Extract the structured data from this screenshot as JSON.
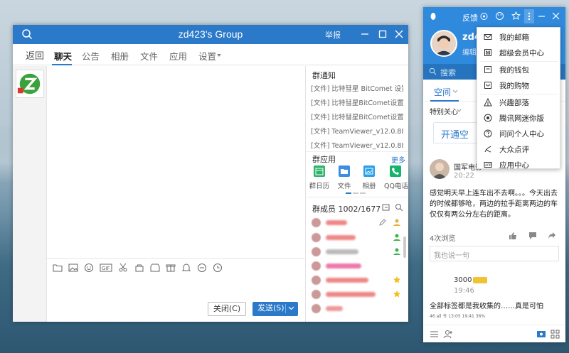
{
  "group_window": {
    "title": "zd423's Group",
    "report": "举报",
    "back": "返回",
    "tabs": [
      "聊天",
      "公告",
      "相册",
      "文件",
      "应用",
      "设置"
    ],
    "notice_header": "群通知",
    "notices": [
      "[文件] 比特彗星 BitComet 设置...",
      "[文件] 比特彗星BitComet设置...",
      "[文件] 比特彗星BitComet设置...",
      "[文件] TeamViewer_v12.0.884...",
      "[文件] TeamViewer_v12.0.884..."
    ],
    "apps_header": "群应用",
    "apps_more": "更多",
    "apps": [
      {
        "label": "群日历",
        "color": "#2fb36d"
      },
      {
        "label": "文件",
        "color": "#3a8ee6"
      },
      {
        "label": "相册",
        "color": "#2aa0e8"
      },
      {
        "label": "QQ电话",
        "color": "#16b36a"
      }
    ],
    "members_header": "群成员 1002/1677",
    "close_button": "关闭(C)",
    "send_button": "发送(S)"
  },
  "qq_panel": {
    "feedback": "反馈",
    "name": "zd4",
    "signature": "编辑",
    "search_placeholder": "搜索",
    "tab_space": "空间",
    "special_care": "特别关心",
    "open_btn": "开通空",
    "post_user": "国军电影",
    "post_time": "20:22",
    "post_text": "感觉明天早上连车出不去啊。。。今天出去的时候都够呛，两边的拉手距离两边的车仅仅有两公分左右的距离。",
    "views": "4次浏览",
    "comment_placeholder": "我也说一句",
    "second_count": "3000",
    "second_time": "19:46",
    "second_text": "全部标签都是我收集的……真是可怕",
    "tiny_bar": "46 all 令 13:05   19:41   36%"
  },
  "menu": {
    "items": [
      {
        "label": "我的邮箱",
        "icon": "mail-icon"
      },
      {
        "label": "超级会员中心",
        "icon": "crown-icon"
      },
      {
        "label": "我的钱包",
        "icon": "wallet-icon"
      },
      {
        "label": "我的购物",
        "icon": "shopping-icon"
      },
      {
        "label": "兴趣部落",
        "icon": "tribe-icon"
      },
      {
        "label": "腾讯网迷你版",
        "icon": "news-icon"
      },
      {
        "label": "问问个人中心",
        "icon": "question-icon"
      },
      {
        "label": "大众点评",
        "icon": "review-icon"
      },
      {
        "label": "应用中心",
        "icon": "app-center-icon"
      }
    ]
  },
  "colors": {
    "accent": "#2b79c9",
    "qq_blue": "#2f89dc"
  }
}
